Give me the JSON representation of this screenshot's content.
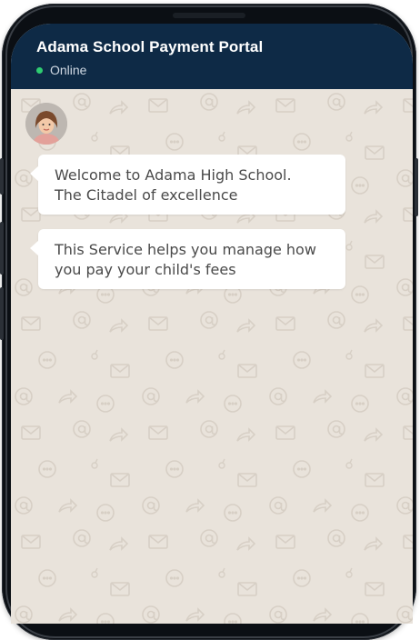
{
  "header": {
    "title": "Adama School Payment Portal",
    "status": "Online"
  },
  "messages": [
    {
      "line1": "Welcome to Adama High School.",
      "line2": "The Citadel of excellence"
    },
    {
      "line1": "This Service helps you manage how",
      "line2": "you pay your child's fees"
    }
  ],
  "colors": {
    "header_bg": "#0e2a46",
    "online_dot": "#2ecc71",
    "chat_bg": "#e9e3db",
    "bubble_bg": "#ffffff"
  },
  "icons": [
    "avatar-woman-icon",
    "mail-icon",
    "at-sign-icon",
    "share-arrow-icon",
    "chat-bubble-icon"
  ]
}
